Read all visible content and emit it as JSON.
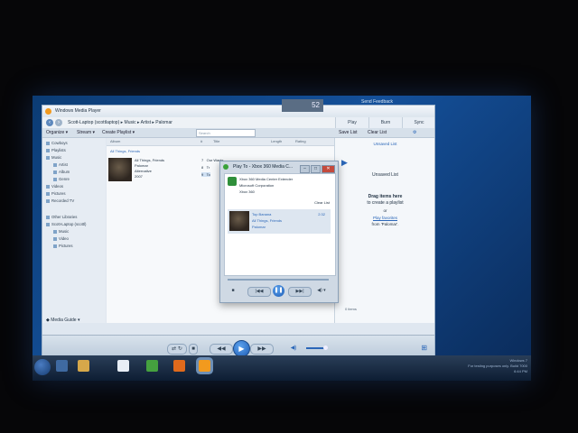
{
  "window": {
    "title": "Windows Media Player"
  },
  "overlay": {
    "send_feedback": "Send Feedback",
    "badge": "52"
  },
  "address": {
    "path": "Scott-Laptop (scottlaptop) ▸ Music ▸ Artist ▸ Palomar"
  },
  "toolbar": {
    "organize": "Organize ▾",
    "stream": "Stream ▾",
    "create_playlist": "Create Playlist ▾",
    "search_placeholder": "Search",
    "save_list": "Save List",
    "clear_list": "Clear List"
  },
  "tabs": [
    {
      "label": "Play"
    },
    {
      "label": "Burn"
    },
    {
      "label": "Sync"
    }
  ],
  "sidebar": {
    "items": [
      {
        "label": "Cowboys"
      },
      {
        "label": "Playlists"
      },
      {
        "label": "Music"
      },
      {
        "label": "Artist"
      },
      {
        "label": "Album"
      },
      {
        "label": "Genre"
      },
      {
        "label": "Videos"
      },
      {
        "label": "Pictures"
      },
      {
        "label": "Recorded TV"
      },
      {
        "label": "Other Libraries"
      },
      {
        "label": "Scott-Laptop (scottl)"
      },
      {
        "label": "Music"
      },
      {
        "label": "Video"
      },
      {
        "label": "Pictures"
      }
    ],
    "media_guide": "Media Guide ▾"
  },
  "content": {
    "columns": {
      "album": "Album",
      "num": "#",
      "title": "Title",
      "length": "Length",
      "rating": "Rating"
    },
    "album_group": "All Things, Friends",
    "album_info": [
      "All Things, Friends",
      "Palomar",
      "Alternative",
      "2007"
    ],
    "tracks": [
      {
        "num": "7",
        "title": "Our Wants"
      },
      {
        "num": "8",
        "title": "Tr"
      },
      {
        "num": "9",
        "title": "To"
      }
    ]
  },
  "rightpane": {
    "unsaved_top": "Unsaved List",
    "unsaved": "Unsaved List",
    "drag_line1": "Drag items here",
    "drag_line2": "to create a playlist",
    "or": "or",
    "play_favorites": "Play favorites",
    "from": "from 'Palomar'.",
    "status": "0 items"
  },
  "dialog": {
    "title": "Play To - Xbox 360 Media C...",
    "device_name": "Xbox 360 Media Center Extender",
    "manufacturer": "Microsoft Corporation",
    "model": "Xbox 360",
    "clear_list": "Clear List",
    "song": {
      "title": "Top Banana",
      "album": "All Things, Friends",
      "artist": "Palomar",
      "length": "2:32"
    }
  },
  "taskbar": {
    "tray_line1": "Windows 7",
    "tray_line2": "For testing purposes only. Build 7000",
    "tray_time": "6:44 PM"
  }
}
